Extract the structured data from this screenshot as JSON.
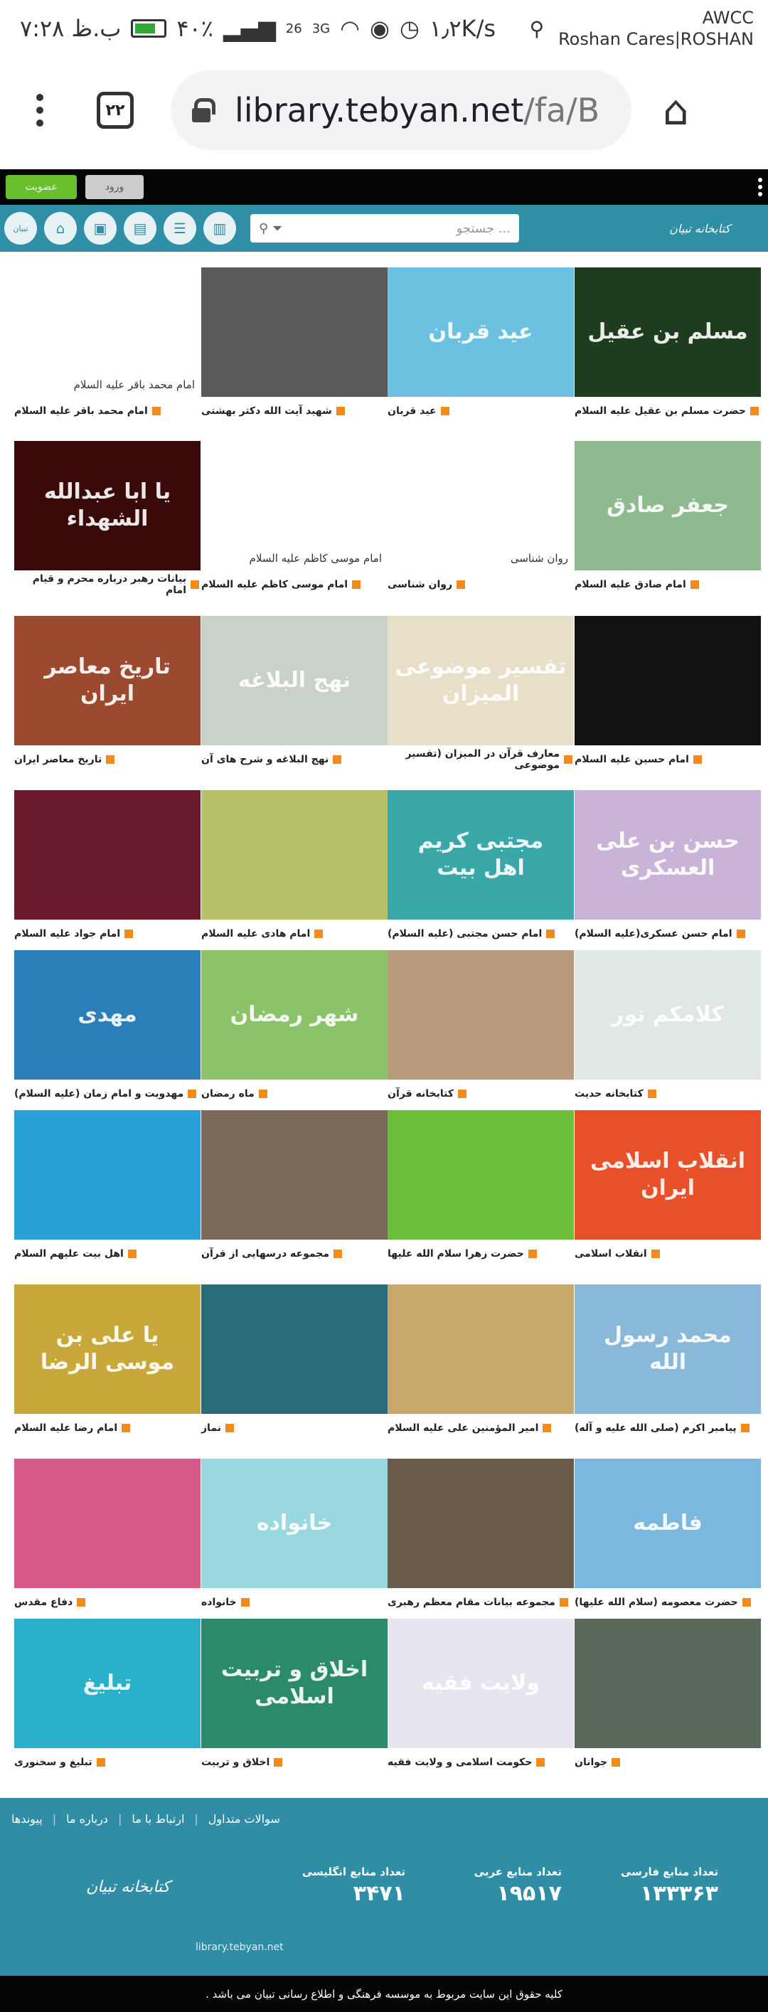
{
  "status": {
    "time": "۷:۲۸ ب.ظ",
    "battery": "۴۰٪",
    "net1": "26",
    "net2": "3G",
    "speed": "۱٫۲K/s",
    "carrier_top": "AWCC",
    "carrier_bottom": "Roshan Cares|ROSHAN"
  },
  "browser": {
    "tab_count": "۲۲",
    "url_host": "library.tebyan.net",
    "url_path": "/fa/B"
  },
  "topbar": {
    "register_label": "عضویت",
    "login_label": "ورود"
  },
  "header": {
    "search_placeholder": "جستجو ...",
    "logo_text": "کتابخانه تبیان",
    "icon_last_label": "تبیان"
  },
  "items": [
    {
      "caption": "حضرت مسلم بن عقیل علیه السلام",
      "art": "مسلم بن عقیل",
      "color": "#1e3d1e"
    },
    {
      "caption": "عید قربان",
      "art": "عید قربان",
      "color": "#6cc1e0"
    },
    {
      "caption": "شهید آیت الله دکتر بهشتی",
      "art": "",
      "color": "#5a5a5a"
    },
    {
      "caption": "امام محمد باقر علیه السلام",
      "art": "امام محمد باقر علیه السلام",
      "color": "broken"
    },
    {
      "caption": "امام صادق علیه السلام",
      "art": "جعفر صادق",
      "color": "#8fb98f"
    },
    {
      "caption": "روان شناسی",
      "art": "روان شناسی",
      "color": "broken"
    },
    {
      "caption": "امام موسی کاظم علیه السلام",
      "art": "امام موسی کاظم علیه السلام",
      "color": "broken"
    },
    {
      "caption": "بیانات رهبر درباره محرم و قیام امام",
      "art": "یا ابا عبدالله الشهداء",
      "color": "#3a0a0a"
    },
    {
      "caption": "امام حسین علیه السلام",
      "art": "",
      "color": "#111111"
    },
    {
      "caption": "معارف قرآن در المیزان (تفسیر موضوعی",
      "art": "تفسیر موضوعی المیزان",
      "color": "#e8dfc8"
    },
    {
      "caption": "نهج البلاغه و شرح های آن",
      "art": "نهج البلاغه",
      "color": "#c9d2c8"
    },
    {
      "caption": "تاریخ معاصر ایران",
      "art": "تاریخ معاصر ایران",
      "color": "#9c4a2f"
    },
    {
      "caption": "امام حسن عسکری(علیه السلام)",
      "art": "حسن بن علی العسکری",
      "color": "#c9b4d8"
    },
    {
      "caption": "امام حسن مجتبی (علیه السلام)",
      "art": "مجتبی کریم اهل بیت",
      "color": "#3aa8a8"
    },
    {
      "caption": "امام هادی علیه السلام",
      "art": "",
      "color": "#b9c06a"
    },
    {
      "caption": "امام جواد علیه السلام",
      "art": "",
      "color": "#6a1a2a"
    },
    {
      "caption": "کتابخانه حدیث",
      "art": "کلامکم نور",
      "color": "#dfe8e3"
    },
    {
      "caption": "کتابخانه قرآن",
      "art": "",
      "color": "#b89b7c"
    },
    {
      "caption": "ماه رمضان",
      "art": "شهر رمضان",
      "color": "#8cc26a"
    },
    {
      "caption": "مهدویت و امام زمان (علیه السلام)",
      "art": "مهدی",
      "color": "#2a7fb8"
    },
    {
      "caption": "انقلاب اسلامی",
      "art": "انقلاب اسلامی ایران",
      "color": "#e8502a"
    },
    {
      "caption": "حضرت زهرا سلام الله علیها",
      "art": "",
      "color": "#6cbf3a"
    },
    {
      "caption": "مجموعه درسهایی از قرآن",
      "art": "",
      "color": "#7a6a5a"
    },
    {
      "caption": "اهل بیت علیهم السلام",
      "art": "",
      "color": "#2aa0d8"
    },
    {
      "caption": "پیامبر اکرم (صلی الله علیه و آله)",
      "art": "محمد رسول الله",
      "color": "#8ab8d8"
    },
    {
      "caption": "امیر المؤمنین علی علیه السلام",
      "art": "",
      "color": "#c8a86a"
    },
    {
      "caption": "نماز",
      "art": "",
      "color": "#2a6a7a"
    },
    {
      "caption": "امام رضا علیه السلام",
      "art": "یا علی بن موسی الرضا",
      "color": "#c8a83a"
    },
    {
      "caption": "حضرت معصومه (سلام الله علیها)",
      "art": "فاطمه",
      "color": "#7ab8e0"
    },
    {
      "caption": "مجموعه بیانات مقام معظم رهبری",
      "art": "",
      "color": "#6a5a4a"
    },
    {
      "caption": "خانواده",
      "art": "خانواده",
      "color": "#9ad8e0"
    },
    {
      "caption": "دفاع مقدس",
      "art": "",
      "color": "#d85a8a"
    },
    {
      "caption": "جوانان",
      "art": "",
      "color": "#5a6a5a"
    },
    {
      "caption": "حکومت اسلامی و ولایت فقیه",
      "art": "ولایت فقیه",
      "color": "#e8e4f0"
    },
    {
      "caption": "اخلاق و تربیت",
      "art": "اخلاق و تربیت اسلامی",
      "color": "#2a8a6a"
    },
    {
      "caption": "تبلیغ و سخنوری",
      "art": "تبلیغ",
      "color": "#2ab0c8"
    }
  ],
  "footer": {
    "links": [
      "سوالات متداول",
      "ارتباط با ما",
      "درباره ما",
      "پیوندها"
    ],
    "stats": [
      {
        "label": "تعداد منابع انگلیسی",
        "value": "۳۴۷۱"
      },
      {
        "label": "تعداد منابع عربی",
        "value": "۱۹۵۱۷"
      },
      {
        "label": "تعداد منابع فارسی",
        "value": "۱۳۳۳۶۳"
      }
    ],
    "logo_text": "کتابخانه تبیان",
    "site": "library.tebyan.net",
    "copyright": "کلیه حقوق این سایت مربوط به موسسه فرهنگی و اطلاع رسانی تبیان می باشد ."
  }
}
